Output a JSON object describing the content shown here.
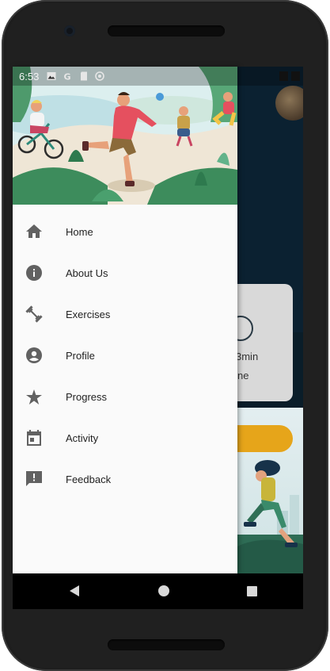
{
  "status_bar": {
    "time": "6:53",
    "left_icons": [
      "gallery-icon",
      "google-icon",
      "sd-card-icon",
      "sync-icon"
    ]
  },
  "drawer": {
    "menu": [
      {
        "label": "Home",
        "icon": "home-icon"
      },
      {
        "label": "About Us",
        "icon": "info-icon"
      },
      {
        "label": "Exercises",
        "icon": "dumbbell-icon"
      },
      {
        "label": "Profile",
        "icon": "account-circle-icon"
      },
      {
        "label": "Progress",
        "icon": "star-icon"
      },
      {
        "label": "Activity",
        "icon": "calendar-icon"
      },
      {
        "label": "Feedback",
        "icon": "feedback-icon"
      }
    ]
  },
  "background": {
    "card_time": "3min",
    "card_label": "ne"
  },
  "colors": {
    "drawer_bg": "#fafafa",
    "icon_gray": "#616161",
    "app_dark": "#0b2131",
    "accent_orange": "#e6a51a",
    "header_green": "#4a9a6a"
  },
  "nav_bar": {
    "buttons": [
      "back-icon",
      "home-circle-icon",
      "recents-icon"
    ]
  }
}
